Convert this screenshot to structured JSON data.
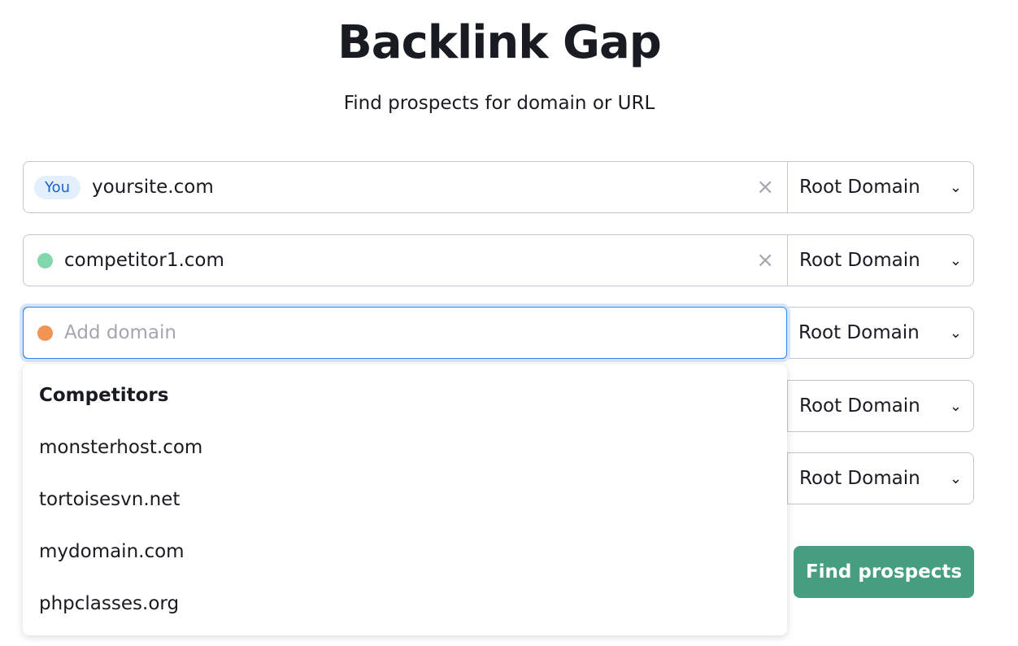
{
  "title": "Backlink Gap",
  "subtitle": "Find prospects for domain or URL",
  "rows": [
    {
      "badge": "You",
      "value": "yoursite.com",
      "type": "Root Domain"
    },
    {
      "value": "competitor1.com",
      "dot": "#7fd7ab",
      "type": "Root Domain"
    },
    {
      "placeholder": "Add domain",
      "dot": "#f29453",
      "type": "Root Domain"
    },
    {
      "type": "Root Domain"
    },
    {
      "type": "Root Domain"
    }
  ],
  "dropdown": {
    "heading": "Competitors",
    "options": [
      "monsterhost.com",
      "tortoisesvn.net",
      "mydomain.com",
      "phpclasses.org"
    ]
  },
  "button": "Find prospects"
}
